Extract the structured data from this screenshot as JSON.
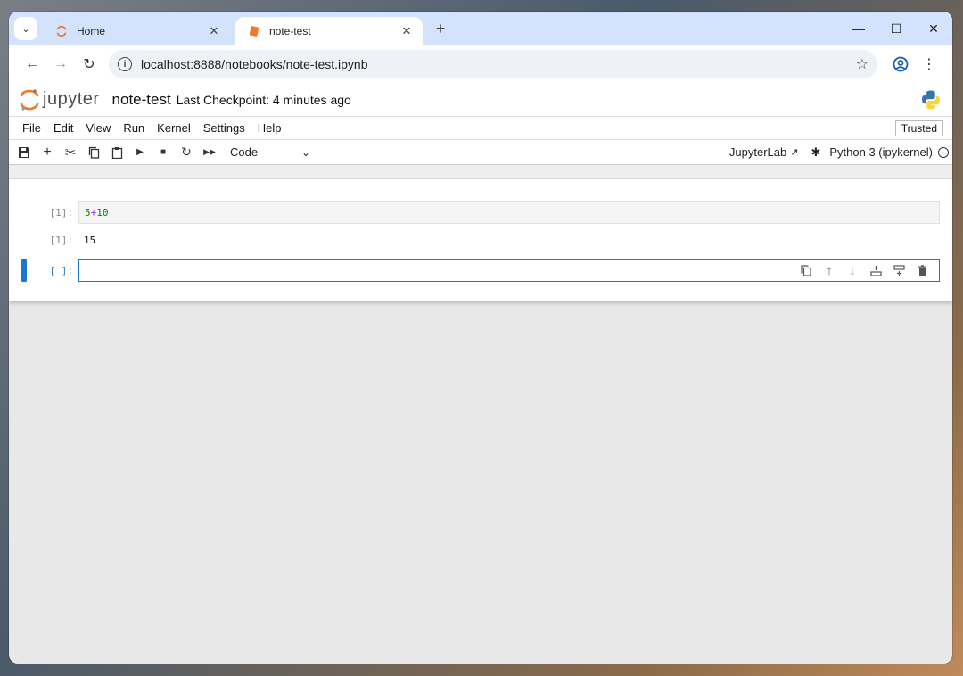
{
  "browser": {
    "tabs": [
      {
        "title": "Home",
        "active": false
      },
      {
        "title": "note-test",
        "active": true
      }
    ],
    "url": "localhost:8888/notebooks/note-test.ipynb"
  },
  "jupyter": {
    "logo_text": "jupyter",
    "notebook_title": "note-test",
    "checkpoint": "Last Checkpoint: 4 minutes ago",
    "menu": [
      "File",
      "Edit",
      "View",
      "Run",
      "Kernel",
      "Settings",
      "Help"
    ],
    "trusted": "Trusted",
    "cell_type": "Code",
    "jupyterlab_link": "JupyterLab",
    "kernel_name": "Python 3 (ipykernel)"
  },
  "cells": [
    {
      "prompt": "[1]:",
      "code_left": "5",
      "code_op": "+",
      "code_right": "10",
      "out_prompt": "[1]:",
      "output": "15"
    },
    {
      "prompt": "[ ]:"
    }
  ],
  "colors": {
    "tabstrip": "#d3e3fd",
    "active_cell": "#1976d2",
    "jupyter_orange": "#f37726"
  }
}
